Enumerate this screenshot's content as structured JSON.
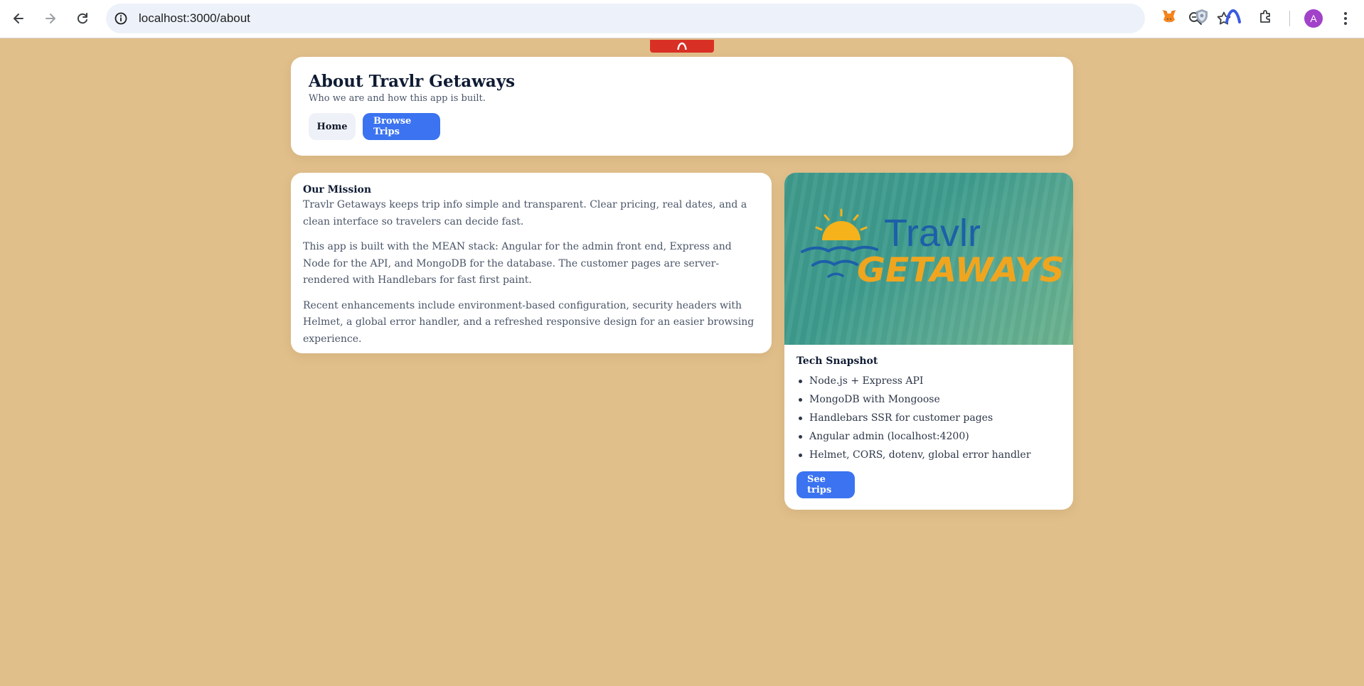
{
  "browser": {
    "url": "localhost:3000/about",
    "avatar_letter": "A"
  },
  "header": {
    "title": "About Travlr Getaways",
    "subtitle": "Who we are and how this app is built.",
    "nav": {
      "home_label": "Home",
      "browse_label": "Browse Trips"
    }
  },
  "mission": {
    "title": "Our Mission",
    "paragraphs": [
      "Travlr Getaways keeps trip info simple and transparent. Clear pricing, real dates, and a clean interface so travelers can decide fast.",
      "This app is built with the MEAN stack: Angular for the admin front end, Express and Node for the API, and MongoDB for the database. The customer pages are server-rendered with Handlebars for fast first paint.",
      "Recent enhancements include environment-based configuration, security headers with Helmet, a global error handler, and a refreshed responsive design for an easier browsing experience."
    ]
  },
  "tech": {
    "logo_line1": "Travlr",
    "logo_line2": "GETAWAYS",
    "title": "Tech Snapshot",
    "items": [
      "Node.js + Express API",
      "MongoDB with Mongoose",
      "Handlebars SSR for customer pages",
      "Angular admin (localhost:4200)",
      "Helmet, CORS, dotenv, global error handler"
    ],
    "button_label": "See trips"
  },
  "colors": {
    "page_bg": "#e1bf8b",
    "primary": "#3b73f0",
    "heading": "#0f1b33"
  }
}
